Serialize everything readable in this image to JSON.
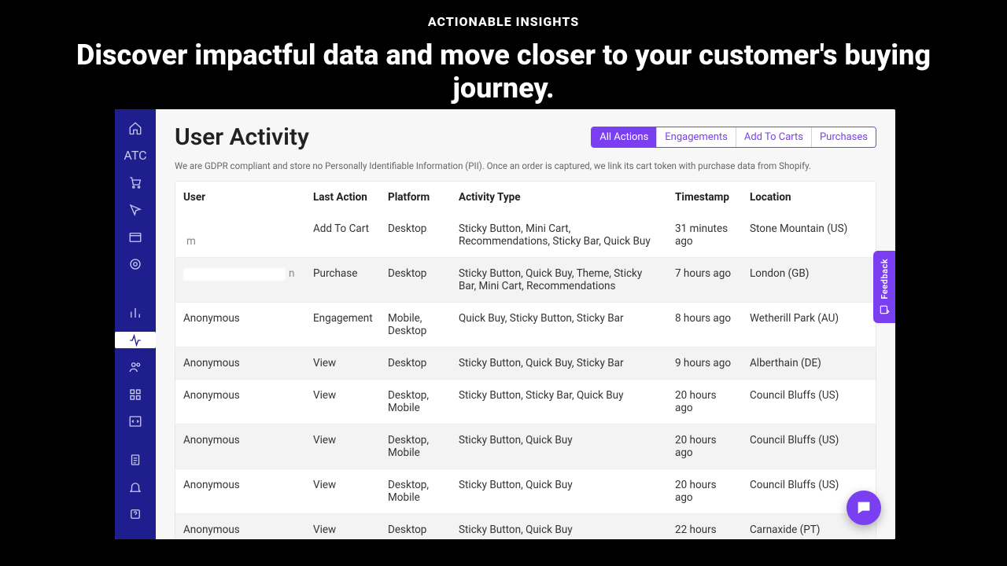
{
  "marketing": {
    "eyebrow": "ACTIONABLE INSIGHTS",
    "headline": "Discover impactful data and move closer to your customer's buying journey."
  },
  "page": {
    "title": "User Activity",
    "subtext": "We are GDPR compliant and store no Personally Identifiable Information (PII). Once an order is captured, we link its cart token with purchase data from Shopify."
  },
  "tabs": [
    {
      "label": "All Actions",
      "active": true
    },
    {
      "label": "Engagements",
      "active": false
    },
    {
      "label": "Add To Carts",
      "active": false
    },
    {
      "label": "Purchases",
      "active": false
    }
  ],
  "columns": {
    "user": "User",
    "last_action": "Last Action",
    "platform": "Platform",
    "activity_type": "Activity Type",
    "timestamp": "Timestamp",
    "location": "Location"
  },
  "rows": [
    {
      "user_redacted": true,
      "user_tail": "m",
      "last_action": "Add To Cart",
      "platform": "Desktop",
      "activity": "Sticky Button, Mini Cart, Recommendations, Sticky Bar, Quick Buy",
      "ts": "31 minutes ago",
      "loc": "Stone Mountain (US)"
    },
    {
      "user_redacted": true,
      "user_tail": "n",
      "last_action": "Purchase",
      "platform": "Desktop",
      "activity": "Sticky Button, Quick Buy, Theme, Sticky Bar, Mini Cart, Recommendations",
      "ts": "7 hours ago",
      "loc": "London (GB)"
    },
    {
      "user": "Anonymous",
      "last_action": "Engagement",
      "platform": "Mobile, Desktop",
      "activity": "Quick Buy, Sticky Button, Sticky Bar",
      "ts": "8 hours ago",
      "loc": "Wetherill Park (AU)"
    },
    {
      "user": "Anonymous",
      "last_action": "View",
      "platform": "Desktop",
      "activity": "Sticky Button, Quick Buy, Sticky Bar",
      "ts": "9 hours ago",
      "loc": "Alberthain (DE)"
    },
    {
      "user": "Anonymous",
      "last_action": "View",
      "platform": "Desktop, Mobile",
      "activity": "Sticky Button, Sticky Bar, Quick Buy",
      "ts": "20 hours ago",
      "loc": "Council Bluffs (US)"
    },
    {
      "user": "Anonymous",
      "last_action": "View",
      "platform": "Desktop, Mobile",
      "activity": "Sticky Button, Quick Buy",
      "ts": "20 hours ago",
      "loc": "Council Bluffs (US)"
    },
    {
      "user": "Anonymous",
      "last_action": "View",
      "platform": "Desktop, Mobile",
      "activity": "Sticky Button, Quick Buy",
      "ts": "20 hours ago",
      "loc": "Council Bluffs (US)"
    },
    {
      "user": "Anonymous",
      "last_action": "View",
      "platform": "Desktop",
      "activity": "Sticky Button, Quick Buy",
      "ts": "22 hours ago",
      "loc": "Carnaxide (PT)"
    }
  ],
  "sidebar": {
    "icons": [
      "home",
      "atc",
      "cart",
      "cursor",
      "window",
      "target",
      "bar-chart",
      "activity",
      "users",
      "grid",
      "code"
    ],
    "bottom_icons": [
      "clipboard",
      "bell",
      "help"
    ],
    "active": "activity"
  },
  "feedback_label": "Feedback"
}
